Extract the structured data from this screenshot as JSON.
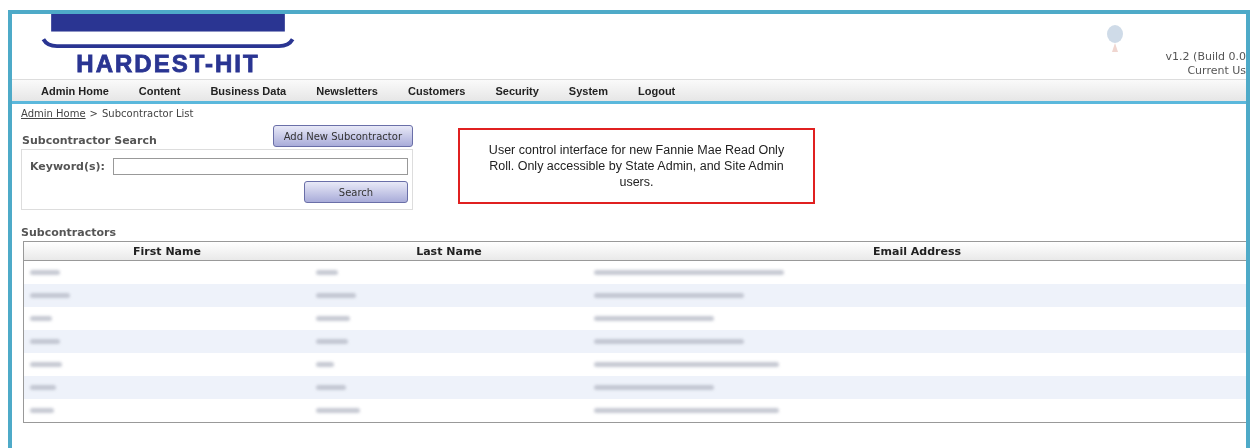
{
  "header": {
    "logo_text": "HARDEST-HIT",
    "version": "v1.2 (Build 0.0",
    "user": "Current Us"
  },
  "nav": [
    {
      "label": "Admin Home"
    },
    {
      "label": "Content"
    },
    {
      "label": "Business Data"
    },
    {
      "label": "Newsletters"
    },
    {
      "label": "Customers"
    },
    {
      "label": "Security"
    },
    {
      "label": "System"
    },
    {
      "label": "Logout"
    }
  ],
  "breadcrumb": {
    "link": "Admin Home",
    "separator": ">",
    "current": "Subcontractor List"
  },
  "search": {
    "title": "Subcontractor Search",
    "add_button": "Add New Subcontractor",
    "keyword_label": "Keyword(s):",
    "search_button": "Search"
  },
  "note": "User control interface for new Fannie Mae Read Only Roll. Only accessible by State Admin, and Site Admin users.",
  "table": {
    "title": "Subcontractors",
    "columns": [
      "First Name",
      "Last Name",
      "Email Address"
    ],
    "rows": [
      {
        "blurred": [
          true,
          true,
          true
        ]
      },
      {
        "blurred": [
          true,
          true,
          true
        ]
      },
      {
        "blurred": [
          true,
          true,
          true
        ]
      },
      {
        "blurred": [
          true,
          true,
          true
        ]
      },
      {
        "blurred": [
          true,
          true,
          true
        ]
      },
      {
        "blurred": [
          true,
          true,
          true
        ]
      },
      {
        "blurred": [
          true,
          true,
          true
        ]
      }
    ]
  }
}
